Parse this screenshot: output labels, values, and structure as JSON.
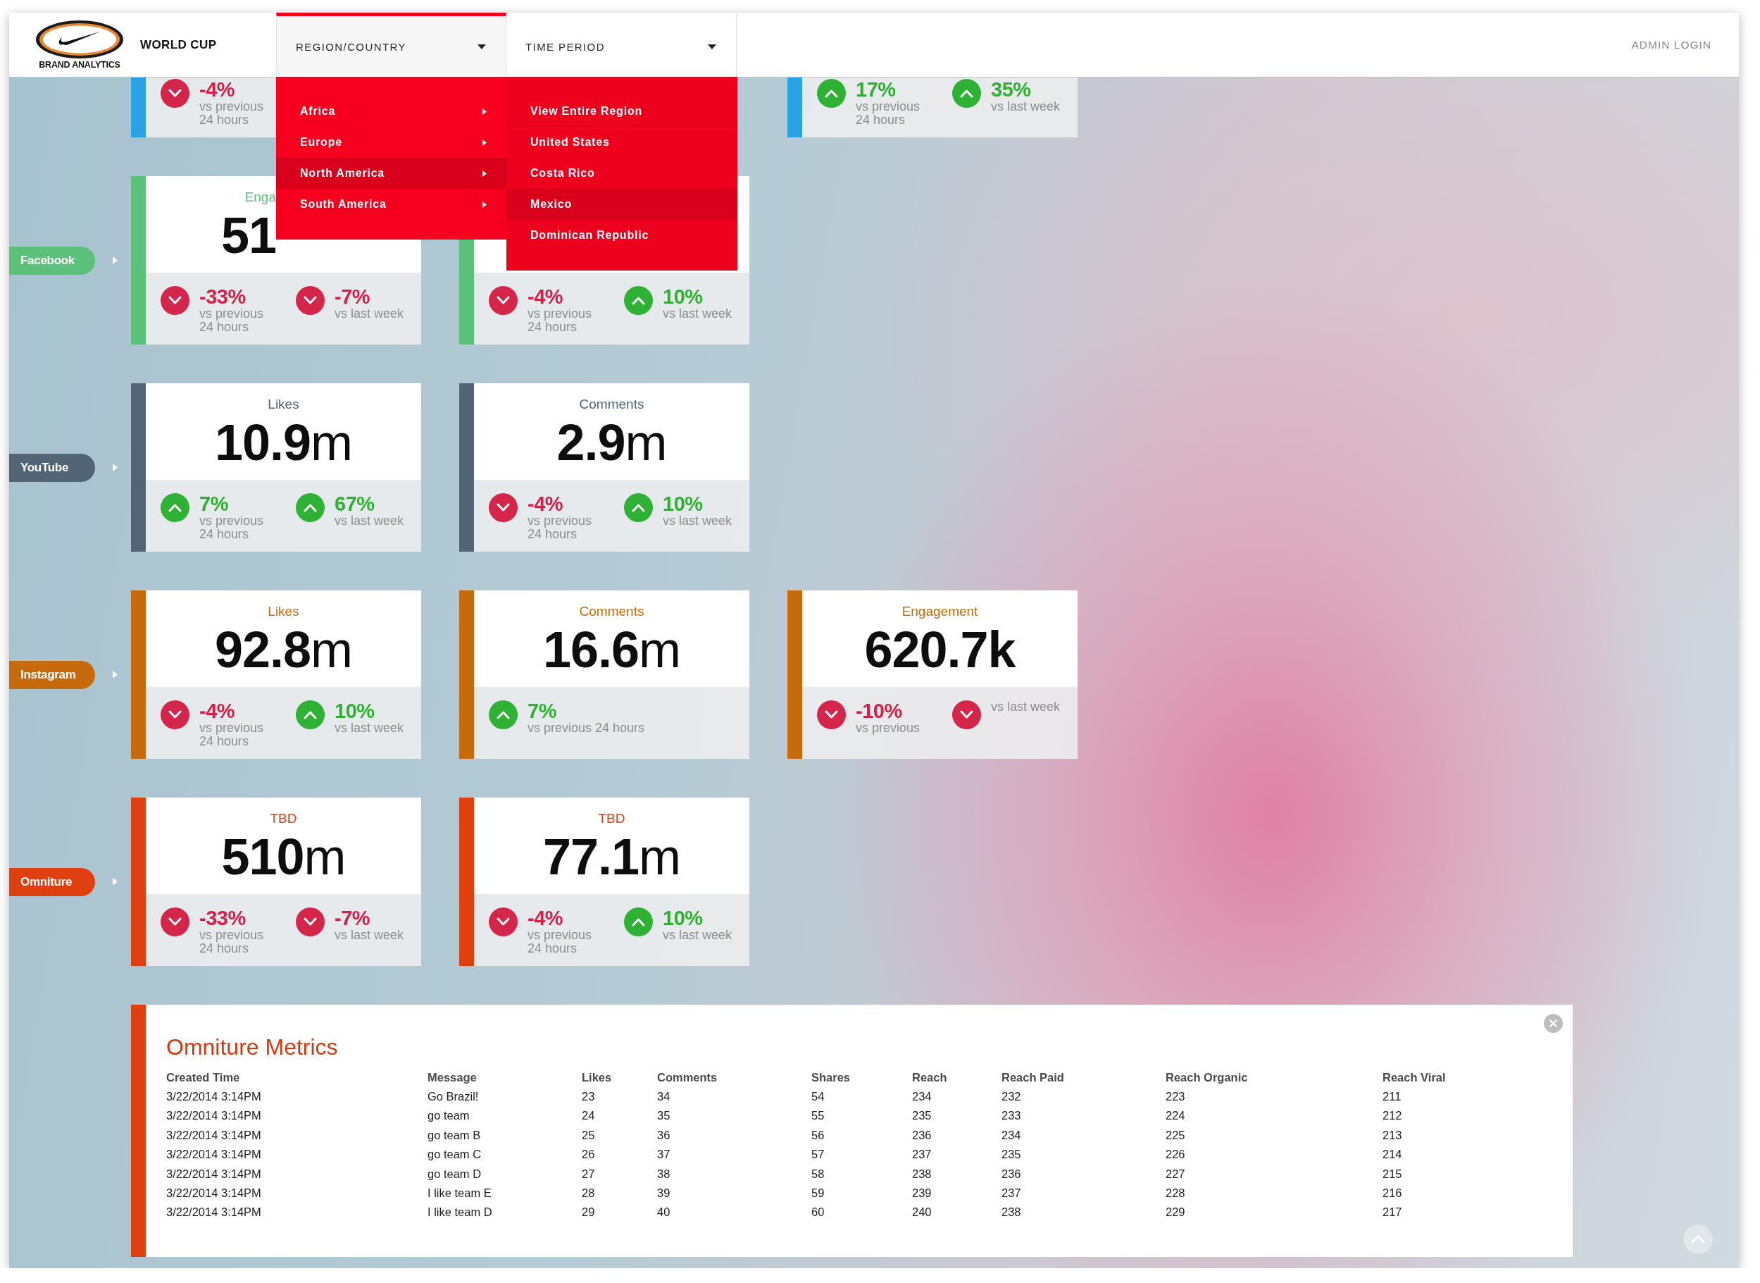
{
  "header": {
    "logo_caption": "BRAND ANALYTICS",
    "title": "WORLD CUP",
    "filters": [
      {
        "label": "REGION/COUNTRY",
        "open": true,
        "menu": [
          {
            "label": "Africa",
            "selected": false
          },
          {
            "label": "Europe",
            "selected": false
          },
          {
            "label": "North America",
            "selected": true,
            "children": [
              {
                "label": "View Entire Region",
                "selected": false
              },
              {
                "label": "United States",
                "selected": false
              },
              {
                "label": "Costa Rico",
                "selected": false
              },
              {
                "label": "Mexico",
                "selected": true
              },
              {
                "label": "Dominican Republic",
                "selected": false
              }
            ]
          },
          {
            "label": "South America",
            "selected": false
          }
        ]
      },
      {
        "label": "TIME PERIOD",
        "open": false
      }
    ],
    "admin_link": "ADMIN LOGIN"
  },
  "channels": [
    {
      "color": "#29a2e6",
      "cards": [
        {
          "kind": "metric",
          "covered": true,
          "stats": [
            {
              "up": false,
              "change": "-4%",
              "note": "vs previous 24 hours"
            }
          ]
        },
        {
          "kind": "hidden"
        },
        {
          "kind": "metric",
          "stats": [
            {
              "up": true,
              "change": "17%",
              "note": "vs previous 24 hours"
            },
            {
              "up": true,
              "change": "35%",
              "note": "vs last week"
            }
          ]
        }
      ]
    },
    {
      "label": "Facebook",
      "color": "#5cc27b",
      "cards": [
        {
          "covered": true,
          "title": "Enga",
          "value": "**51**",
          "stats": [
            {
              "up": false,
              "change": "-33%",
              "note": "vs previous 24 hours"
            },
            {
              "up": false,
              "change": "-7%",
              "note": "vs last week"
            }
          ]
        },
        {
          "stats": [
            {
              "up": false,
              "change": "-4%",
              "note": "vs previous 24 hours"
            },
            {
              "up": true,
              "change": "10%",
              "note": "vs last week"
            }
          ]
        }
      ]
    },
    {
      "label": "YouTube",
      "color": "#536476",
      "cards": [
        {
          "title": "Likes",
          "value": "**10.9**m",
          "stats": [
            {
              "up": true,
              "change": "7%",
              "note": "vs previous 24 hours"
            },
            {
              "up": true,
              "change": "67%",
              "note": "vs last week"
            }
          ]
        },
        {
          "title": "Comments",
          "value": "**2.9**m",
          "stats": [
            {
              "up": false,
              "change": "-4%",
              "note": "vs previous 24 hours"
            },
            {
              "up": true,
              "change": "10%",
              "note": "vs last week"
            }
          ]
        }
      ]
    },
    {
      "label": "Instagram",
      "color": "#c76a0b",
      "cards": [
        {
          "title": "Likes",
          "value": "**92.8**m",
          "stats": [
            {
              "up": false,
              "change": "-4%",
              "note": "vs previous 24 hours"
            },
            {
              "up": true,
              "change": "10%",
              "note": "vs last week"
            }
          ]
        },
        {
          "title": "Comments",
          "value": "**16.6**m",
          "stats": [
            {
              "up": true,
              "change": "7%",
              "note": "vs previous 24 hours"
            }
          ]
        },
        {
          "title": "Engagement",
          "value": "**620.7k**",
          "stats": [
            {
              "up": false,
              "change": "-10%",
              "note": "vs previous"
            },
            {
              "up": false,
              "note": "vs last week"
            }
          ]
        }
      ]
    },
    {
      "label": "Omniture",
      "color": "#e0400f",
      "cards": [
        {
          "title": "TBD",
          "value": "**510**m",
          "stats": [
            {
              "up": false,
              "change": "-33%",
              "note": "vs previous 24 hours"
            },
            {
              "up": false,
              "change": "-7%",
              "note": "vs last week"
            }
          ]
        },
        {
          "title": "TBD",
          "value": "**77.1**m",
          "stats": [
            {
              "up": false,
              "change": "-4%",
              "note": "vs previous 24 hours"
            },
            {
              "up": true,
              "change": "10%",
              "note": "vs last week"
            }
          ]
        }
      ]
    }
  ],
  "metrics_panel": {
    "title": "Omniture Metrics",
    "columns": [
      "Created Time",
      "Message",
      "Likes",
      "Comments",
      "Shares",
      "Reach",
      "Reach Paid",
      "Reach Organic",
      "Reach Viral"
    ],
    "rows": [
      [
        "3/22/2014 3:14PM",
        "Go Brazil!",
        "23",
        "34",
        "54",
        "234",
        "232",
        "223",
        "211"
      ],
      [
        "3/22/2014 3:14PM",
        "go team",
        "24",
        "35",
        "55",
        "235",
        "233",
        "224",
        "212"
      ],
      [
        "3/22/2014 3:14PM",
        "go team B",
        "25",
        "36",
        "56",
        "236",
        "234",
        "225",
        "213"
      ],
      [
        "3/22/2014 3:14PM",
        "go team C",
        "26",
        "37",
        "57",
        "237",
        "235",
        "226",
        "214"
      ],
      [
        "3/22/2014 3:14PM",
        "go team D",
        "27",
        "38",
        "58",
        "238",
        "236",
        "227",
        "215"
      ],
      [
        "3/22/2014 3:14PM",
        "I like team E",
        "28",
        "39",
        "59",
        "239",
        "237",
        "228",
        "216"
      ],
      [
        "3/22/2014 3:14PM",
        "I like team D",
        "29",
        "40",
        "60",
        "240",
        "238",
        "229",
        "217"
      ]
    ]
  }
}
